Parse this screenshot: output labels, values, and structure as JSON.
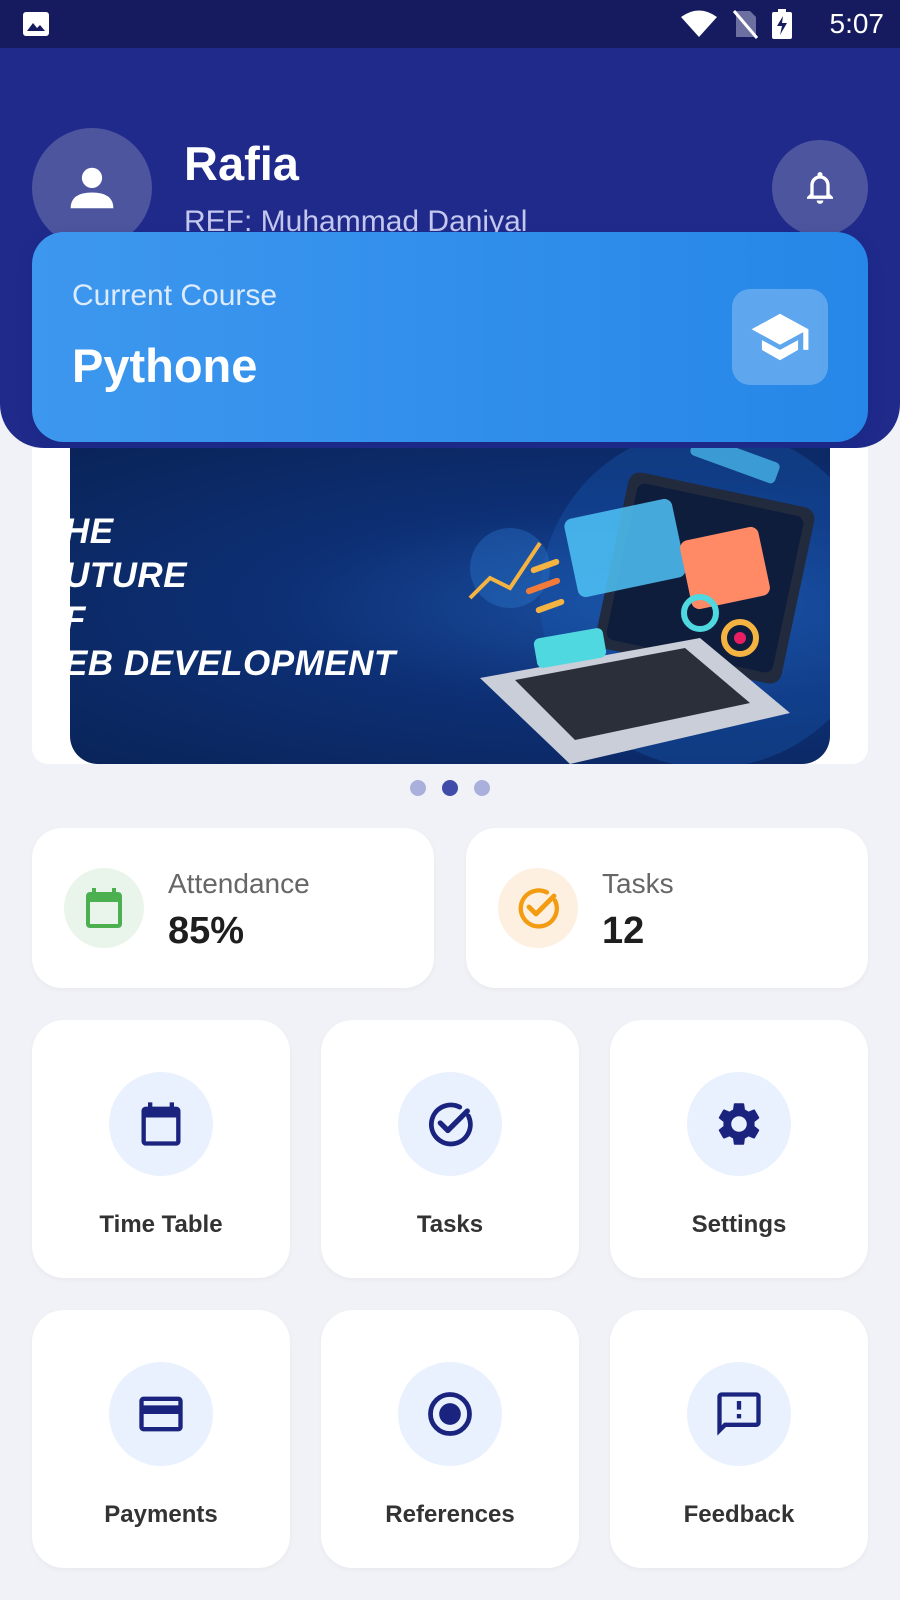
{
  "status_bar": {
    "time": "5:07"
  },
  "header": {
    "name": "Rafia",
    "ref": "REF: Muhammad Daniyal"
  },
  "course": {
    "label": "Current Course",
    "name": "Pythone"
  },
  "banner": {
    "text": "HE\nUTURE\nF\nEB DEVELOPMENT",
    "dots": [
      false,
      true,
      false
    ]
  },
  "stats": {
    "attendance": {
      "label": "Attendance",
      "value": "85%",
      "color": "#4caf50",
      "bg": "#e9f5ea"
    },
    "tasks": {
      "label": "Tasks",
      "value": "12",
      "color": "#f39c12",
      "bg": "#fdf0e1"
    }
  },
  "tiles": [
    {
      "label": "Time Table",
      "icon": "calendar-icon"
    },
    {
      "label": "Tasks",
      "icon": "task-check-icon"
    },
    {
      "label": "Settings",
      "icon": "gear-icon"
    },
    {
      "label": "Payments",
      "icon": "credit-card-icon"
    },
    {
      "label": "References",
      "icon": "radio-button-icon"
    },
    {
      "label": "Feedback",
      "icon": "feedback-icon"
    }
  ],
  "colors": {
    "header": "#1f2a8b",
    "course_card": "#2f8eea",
    "icon_navy": "#1a237e",
    "tile_icon_bg": "#e8f1fd"
  }
}
